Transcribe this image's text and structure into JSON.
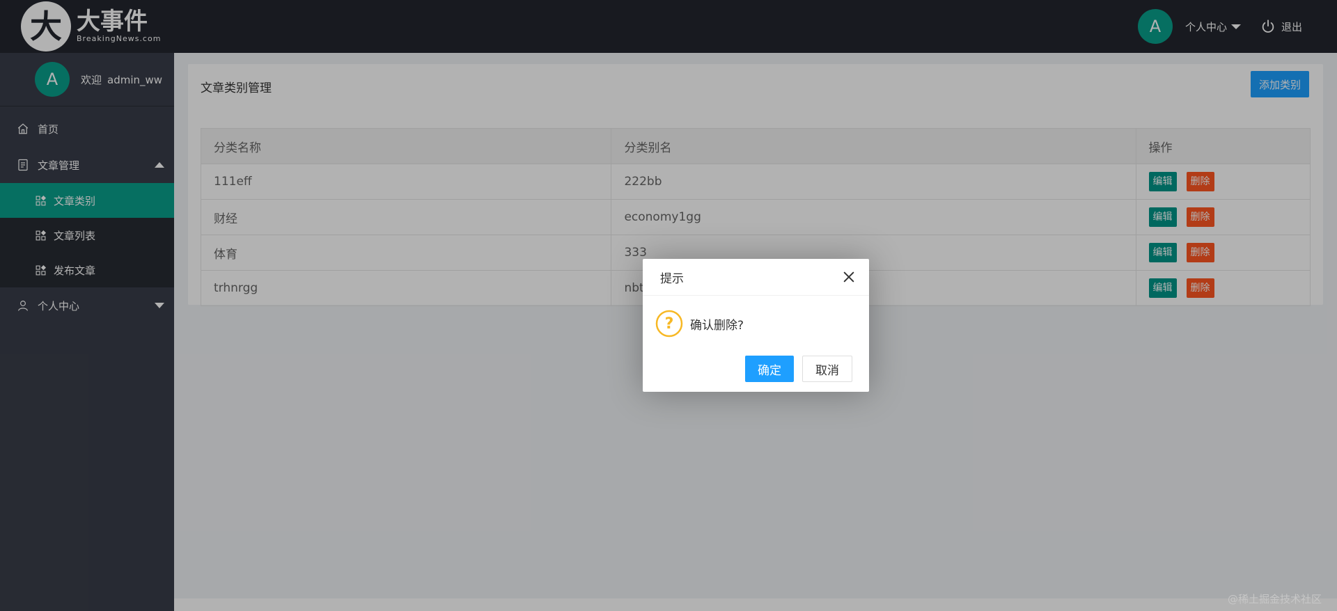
{
  "header": {
    "logo_title": "大事件",
    "logo_sub": "BreakingNews.com",
    "avatar_letter": "A",
    "user_menu": "个人中心",
    "logout": "退出"
  },
  "sidebar": {
    "avatar_letter": "A",
    "welcome": "欢迎",
    "username": "admin_ww",
    "items": [
      {
        "label": "首页",
        "icon": "home-icon"
      },
      {
        "label": "文章管理",
        "icon": "document-icon"
      },
      {
        "label": "个人中心",
        "icon": "user-icon"
      }
    ],
    "sub_items": [
      {
        "label": "文章类别",
        "icon": "grid-icon",
        "active": true
      },
      {
        "label": "文章列表",
        "icon": "grid-icon",
        "active": false
      },
      {
        "label": "发布文章",
        "icon": "grid-icon",
        "active": false
      }
    ]
  },
  "main": {
    "title": "文章类别管理",
    "add_button": "添加类别",
    "table": {
      "headers": [
        "分类名称",
        "分类别名",
        "操作"
      ],
      "rows": [
        {
          "name": "111eff",
          "alias": "222bb"
        },
        {
          "name": "财经",
          "alias": "economy1gg"
        },
        {
          "name": "体育",
          "alias": "333"
        },
        {
          "name": "trhnrgg",
          "alias": "nbt"
        }
      ],
      "edit_label": "编辑",
      "delete_label": "删除"
    }
  },
  "dialog": {
    "title": "提示",
    "message": "确认删除?",
    "ok": "确定",
    "cancel": "取消"
  },
  "watermark": "@稀土掘金技术社区",
  "colors": {
    "header_bg": "#23262e",
    "sidebar_bg": "#393d49",
    "accent": "#0aa08b",
    "primary": "#1e9fff",
    "danger": "#ff5722"
  }
}
